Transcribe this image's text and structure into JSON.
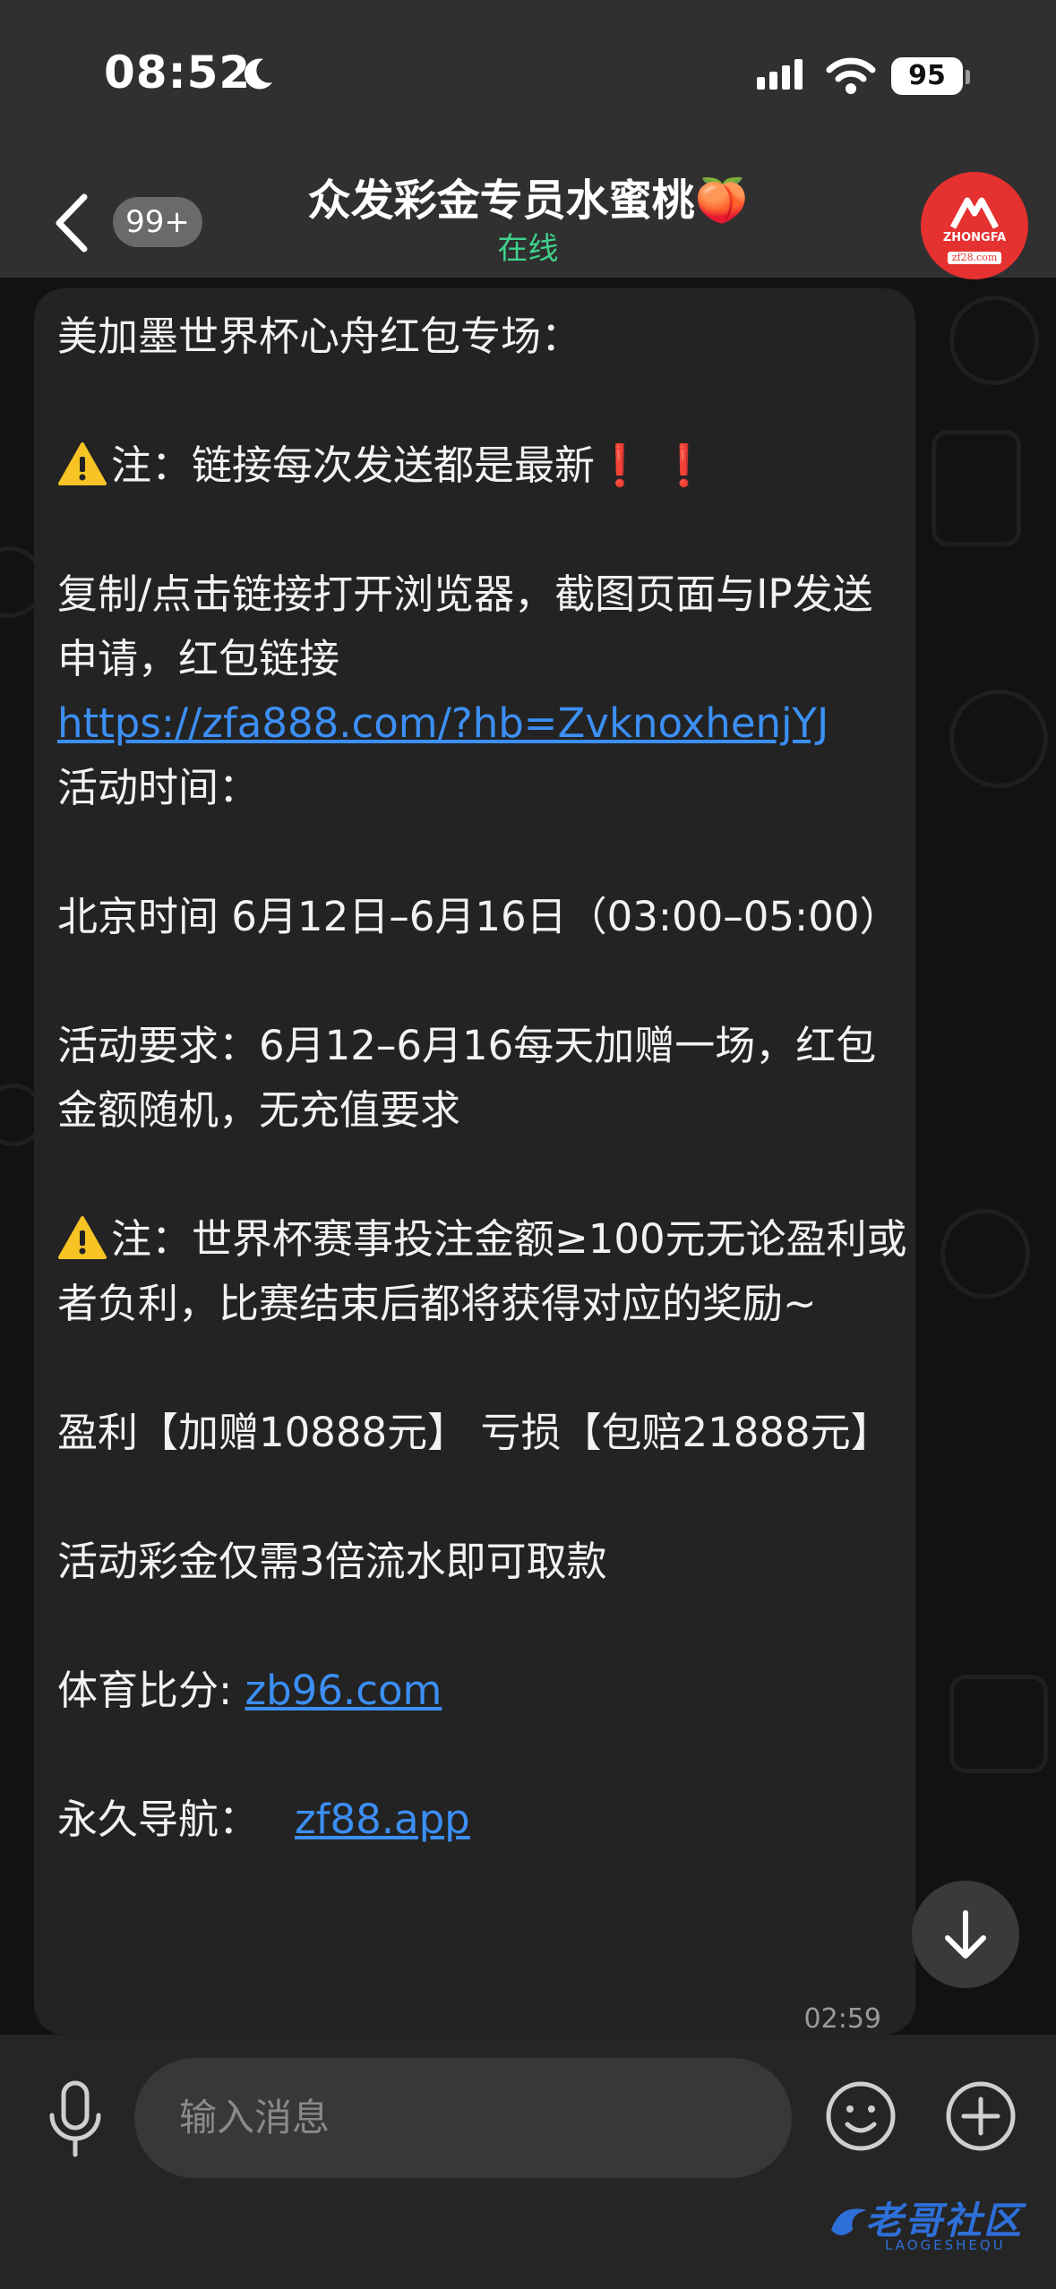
{
  "status_bar": {
    "time": "08:52",
    "battery": "95"
  },
  "header": {
    "unread_badge": "99+",
    "title": "众发彩金专员水蜜桃🍑",
    "status": "在线",
    "avatar_text": "ZHONGFA",
    "avatar_url": "zf28.com"
  },
  "message": {
    "line1": "美加墨世界杯心舟红包专场：",
    "note1": "注：链接每次发送都是最新",
    "note1_marks": "❗ ❗",
    "line_copy": "复制/点击链接打开浏览器，截图页面与IP发送申请，红包链接",
    "link1": "https://zfa888.com/?hb=ZvknoxhenjYJ",
    "line_time_label": "活动时间：",
    "line_beijing": "北京时间 6月12日–6月16日（03:00–05:00）",
    "line_req": "活动要求：6月12–6月16每天加赠一场，红包金额随机，无充值要求",
    "note2": "注：世界杯赛事投注金额≥100元无论盈利或者负利，比赛结束后都将获得对应的奖励~",
    "line_reward": "盈利【加赠10888元】 亏损【包赔21888元】",
    "line_turnover": "活动彩金仅需3倍流水即可取款",
    "score_label": "体育比分: ",
    "score_link": "zb96.com",
    "nav_label": "永久导航：",
    "nav_link": "zf88.app",
    "timestamp": "02:59"
  },
  "input": {
    "placeholder": "输入消息"
  },
  "watermark": {
    "text": "老哥社区",
    "sub": "LAOGESHEQU"
  },
  "colors": {
    "accent_link": "#3c8ff5",
    "online": "#3fd18b",
    "avatar": "#e5312f"
  }
}
